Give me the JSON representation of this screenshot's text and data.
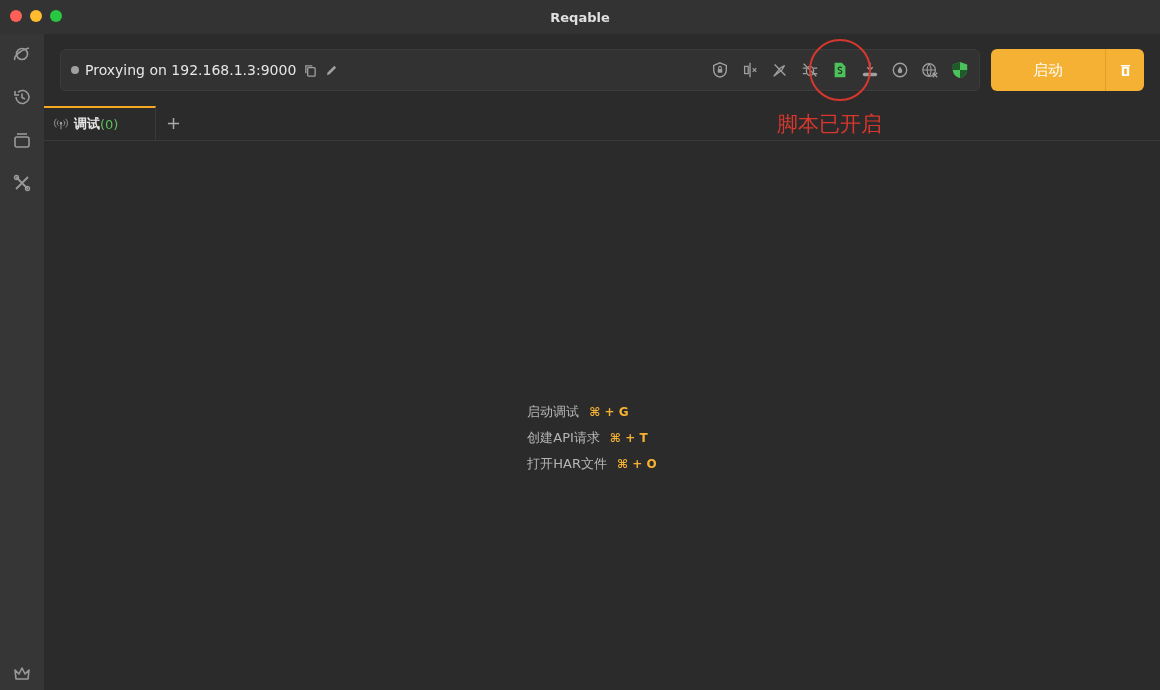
{
  "window": {
    "title": "Reqable"
  },
  "proxy": {
    "text": "Proxying on 192.168.1.3:9000",
    "running": false
  },
  "toolbar_icons": [
    {
      "kind": "ssl",
      "on": false,
      "circled": false
    },
    {
      "kind": "throttle",
      "on": false,
      "circled": false
    },
    {
      "kind": "breakpoint",
      "on": false,
      "circled": false
    },
    {
      "kind": "debug",
      "on": false,
      "circled": false
    },
    {
      "kind": "script",
      "on": true,
      "circled": true
    },
    {
      "kind": "rewrite",
      "on": false,
      "circled": false
    },
    {
      "kind": "target",
      "on": false,
      "circled": false
    },
    {
      "kind": "network",
      "on": false,
      "circled": false
    },
    {
      "kind": "shield",
      "on": true,
      "circled": false
    }
  ],
  "start_button": {
    "label": "启动"
  },
  "tabs": [
    {
      "label": "调试",
      "count": "(0)",
      "selected": true
    }
  ],
  "hints": [
    {
      "label": "启动调试",
      "shortcut": "⌘ + G"
    },
    {
      "label": "创建API请求",
      "shortcut": "⌘ + T"
    },
    {
      "label": "打开HAR文件",
      "shortcut": "⌘ + O"
    }
  ],
  "annotation": {
    "text": "脚本已开启"
  }
}
